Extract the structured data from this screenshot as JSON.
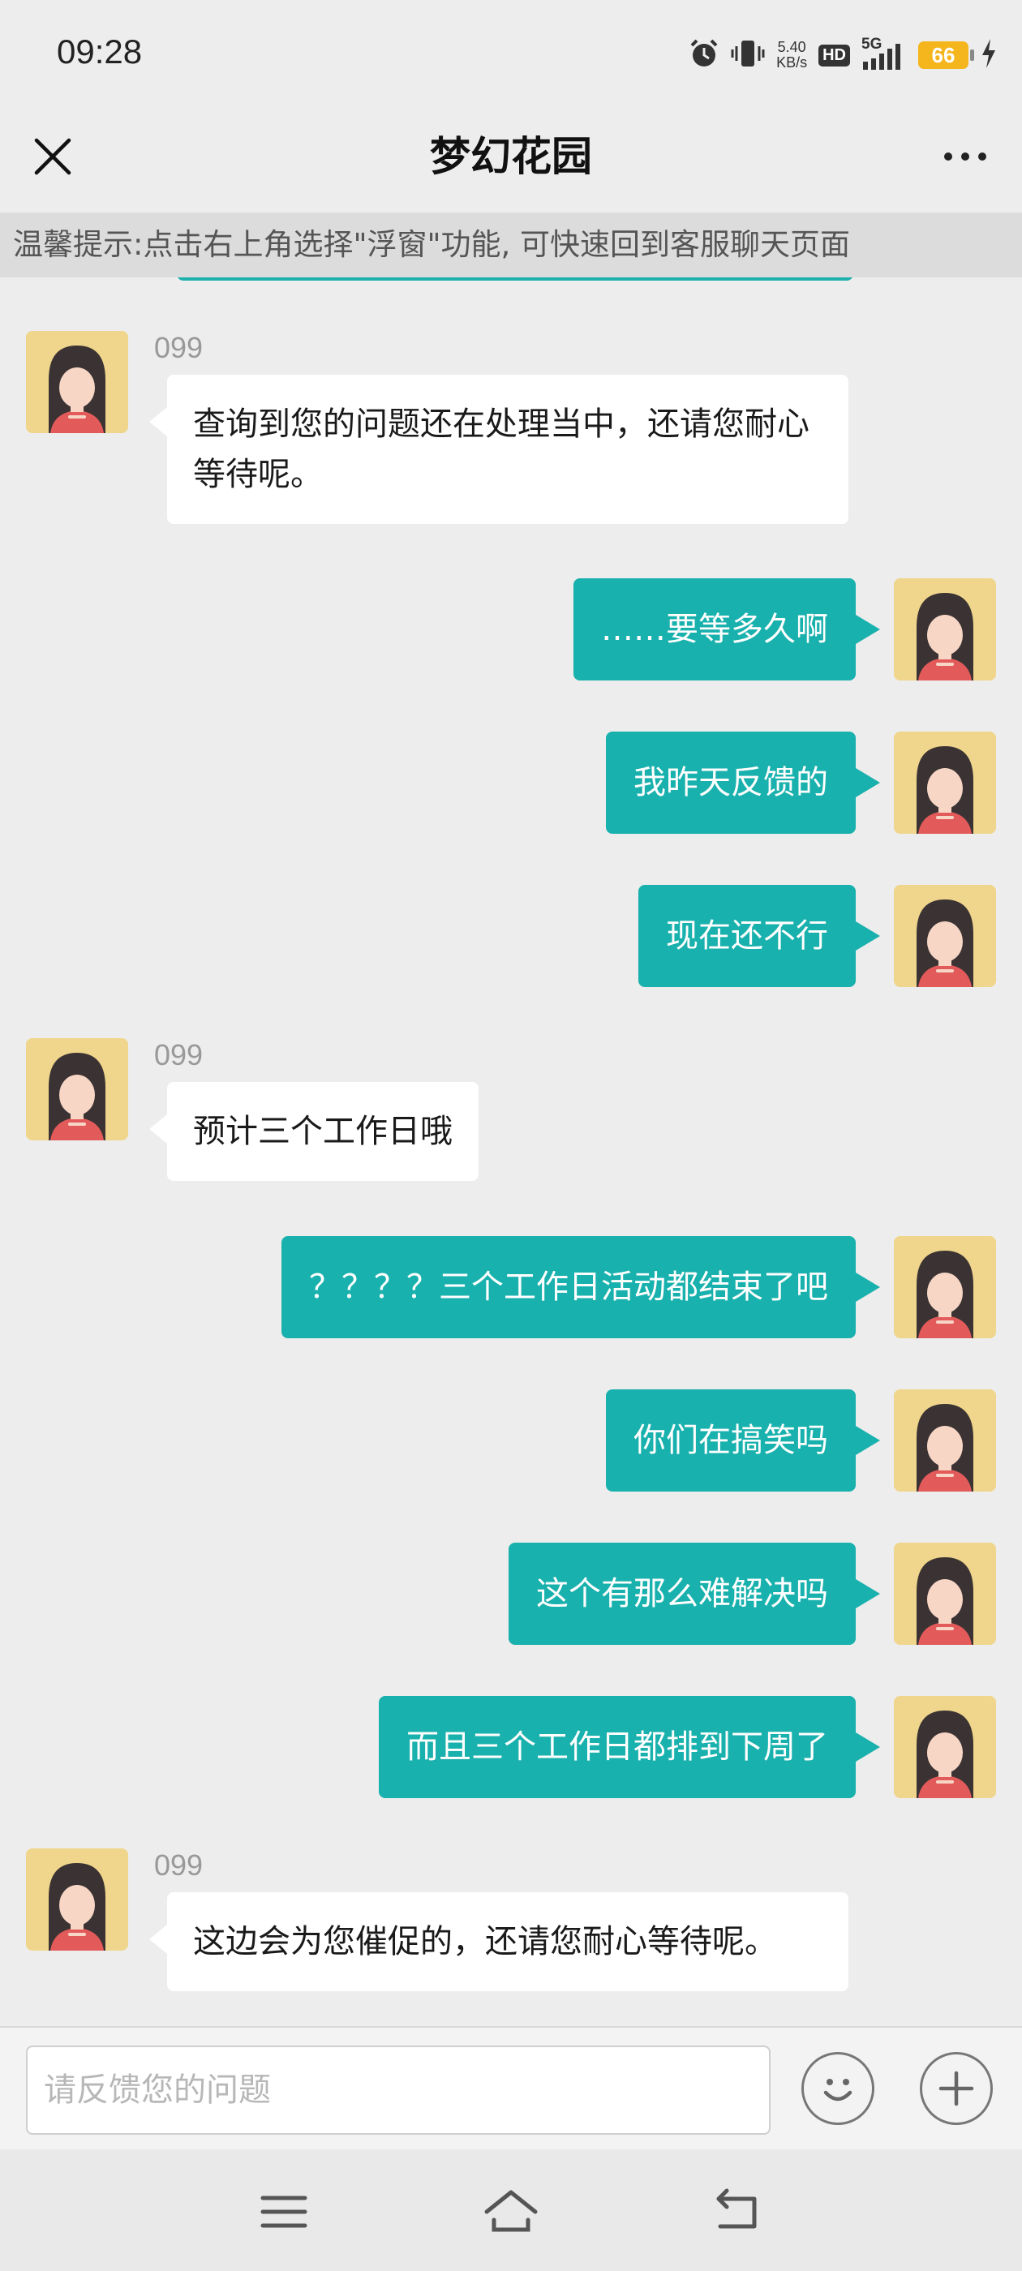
{
  "status_bar": {
    "time": "09:28",
    "net_speed_value": "5.40",
    "net_speed_unit": "KB/s",
    "hd_label": "HD",
    "network_label": "5G",
    "battery_level": "66"
  },
  "nav": {
    "title": "梦幻花园",
    "close_icon": "close-icon",
    "more_icon": "more-icon"
  },
  "tip": {
    "text": "温馨提示:点击右上角选择\"浮窗\"功能, 可快速回到客服聊天页面"
  },
  "messages": [
    {
      "side": "in",
      "sender": "099",
      "text": "查询到您的问题还在处理当中，还请您耐心等待呢。"
    },
    {
      "side": "out",
      "text": "……要等多久啊"
    },
    {
      "side": "out",
      "text": "我昨天反馈的"
    },
    {
      "side": "out",
      "text": "现在还不行"
    },
    {
      "side": "in",
      "sender": "099",
      "text": "预计三个工作日哦"
    },
    {
      "side": "out",
      "text": "？？？？三个工作日活动都结束了吧"
    },
    {
      "side": "out",
      "text": "你们在搞笑吗"
    },
    {
      "side": "out",
      "text": "这个有那么难解决吗"
    },
    {
      "side": "out",
      "text": "而且三个工作日都排到下周了"
    },
    {
      "side": "in",
      "sender": "099",
      "text": "这边会为您催促的，还请您耐心等待呢。"
    }
  ],
  "input_bar": {
    "placeholder": "请反馈您的问题",
    "value": "",
    "emoji_icon": "smiley-icon",
    "add_icon": "plus-icon"
  },
  "system_nav": {
    "menu_icon": "menu-icon",
    "home_icon": "home-icon",
    "back_icon": "back-icon"
  },
  "colors": {
    "background": "#ededed",
    "outgoing_bubble": "#19b1ad",
    "incoming_bubble": "#ffffff",
    "avatar_bg": "#f0d68c",
    "battery": "#f5b51c"
  }
}
